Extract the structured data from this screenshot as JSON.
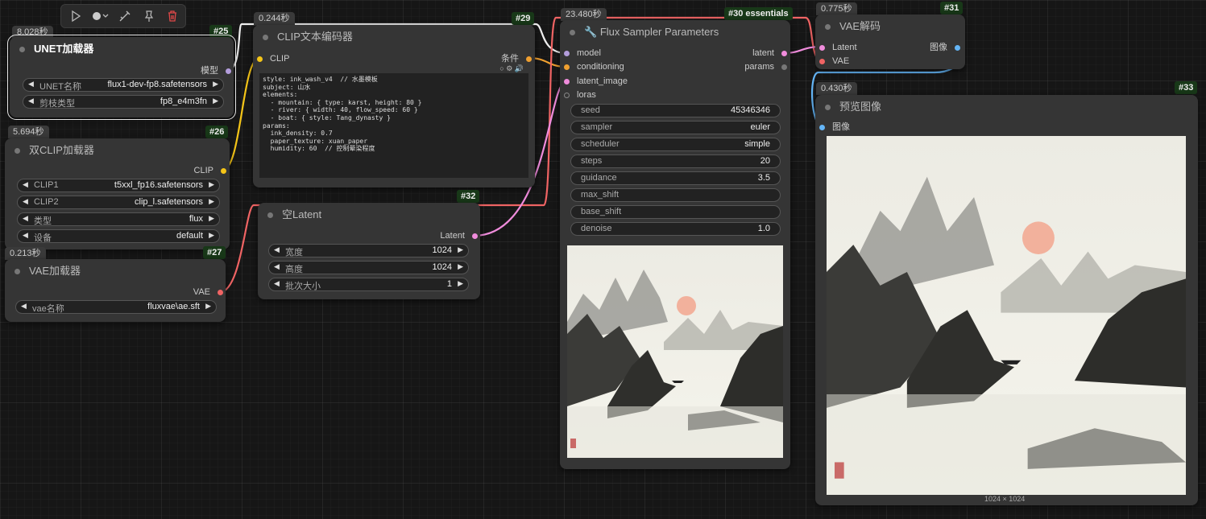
{
  "toolbar": {
    "icons": [
      "play-icon",
      "record-icon",
      "bypass-icon",
      "pin-icon",
      "delete-icon"
    ],
    "colors": {
      "delete": "#e04848"
    }
  },
  "nodes": {
    "unet": {
      "time": "8.028秒",
      "id": "#25",
      "title": "UNET加载器",
      "output": "模型",
      "widgets": [
        {
          "label": "UNET名称",
          "value": "flux1-dev-fp8.safetensors"
        },
        {
          "label": "剪枝类型",
          "value": "fp8_e4m3fn"
        }
      ]
    },
    "dualclip": {
      "time": "5.694秒",
      "id": "#26",
      "title": "双CLIP加载器",
      "output": "CLIP",
      "widgets": [
        {
          "label": "CLIP1",
          "value": "t5xxl_fp16.safetensors"
        },
        {
          "label": "CLIP2",
          "value": "clip_l.safetensors"
        },
        {
          "label": "类型",
          "value": "flux"
        },
        {
          "label": "设备",
          "value": "default"
        }
      ]
    },
    "vaeloader": {
      "time": "0.213秒",
      "id": "#27",
      "title": "VAE加载器",
      "output": "VAE",
      "widgets": [
        {
          "label": "vae名称",
          "value": "fluxvae\\ae.sft"
        }
      ]
    },
    "clipenc": {
      "time": "0.244秒",
      "id": "#29",
      "title": "CLIP文本编码器",
      "input": "CLIP",
      "output": "条件",
      "text": "style: ink_wash_v4  // 水墨模板\nsubject: 山水\nelements:\n  - mountain: { type: karst, height: 80 }\n  - river: { width: 40, flow_speed: 60 }\n  - boat: { style: Tang_dynasty }\nparams:\n  ink_density: 0.7\n  paper_texture: xuan_paper\n  humidity: 60  // 控制晕染程度"
    },
    "latent": {
      "time": "",
      "id": "#32",
      "title": "空Latent",
      "output": "Latent",
      "widgets": [
        {
          "label": "宽度",
          "value": "1024"
        },
        {
          "label": "高度",
          "value": "1024"
        },
        {
          "label": "批次大小",
          "value": "1"
        }
      ]
    },
    "sampler": {
      "time": "23.480秒",
      "id": "#30 essentials",
      "title": "Flux Sampler Parameters",
      "inputs": [
        "model",
        "conditioning",
        "latent_image",
        "loras"
      ],
      "outputs": [
        "latent",
        "params"
      ],
      "widgets": [
        {
          "label": "seed",
          "value": "45346346"
        },
        {
          "label": "sampler",
          "value": "euler"
        },
        {
          "label": "scheduler",
          "value": "simple"
        },
        {
          "label": "steps",
          "value": "20"
        },
        {
          "label": "guidance",
          "value": "3.5"
        },
        {
          "label": "max_shift",
          "value": ""
        },
        {
          "label": "base_shift",
          "value": ""
        },
        {
          "label": "denoise",
          "value": "1.0"
        }
      ]
    },
    "vaedecode": {
      "time": "0.775秒",
      "id": "#31",
      "title": "VAE解码",
      "inputs": [
        "Latent",
        "VAE"
      ],
      "output": "图像"
    },
    "preview": {
      "time": "0.430秒",
      "id": "#33",
      "title": "预览图像",
      "input": "图像",
      "dims": "1024 × 1024"
    }
  },
  "colors": {
    "model": "#b39ddb",
    "clip": "#f5c518",
    "conditioning": "#f0a030",
    "latent": "#f08cdc",
    "vae": "#f06464",
    "image": "#64b5f6",
    "loras": "#888888",
    "params": "#888888"
  }
}
